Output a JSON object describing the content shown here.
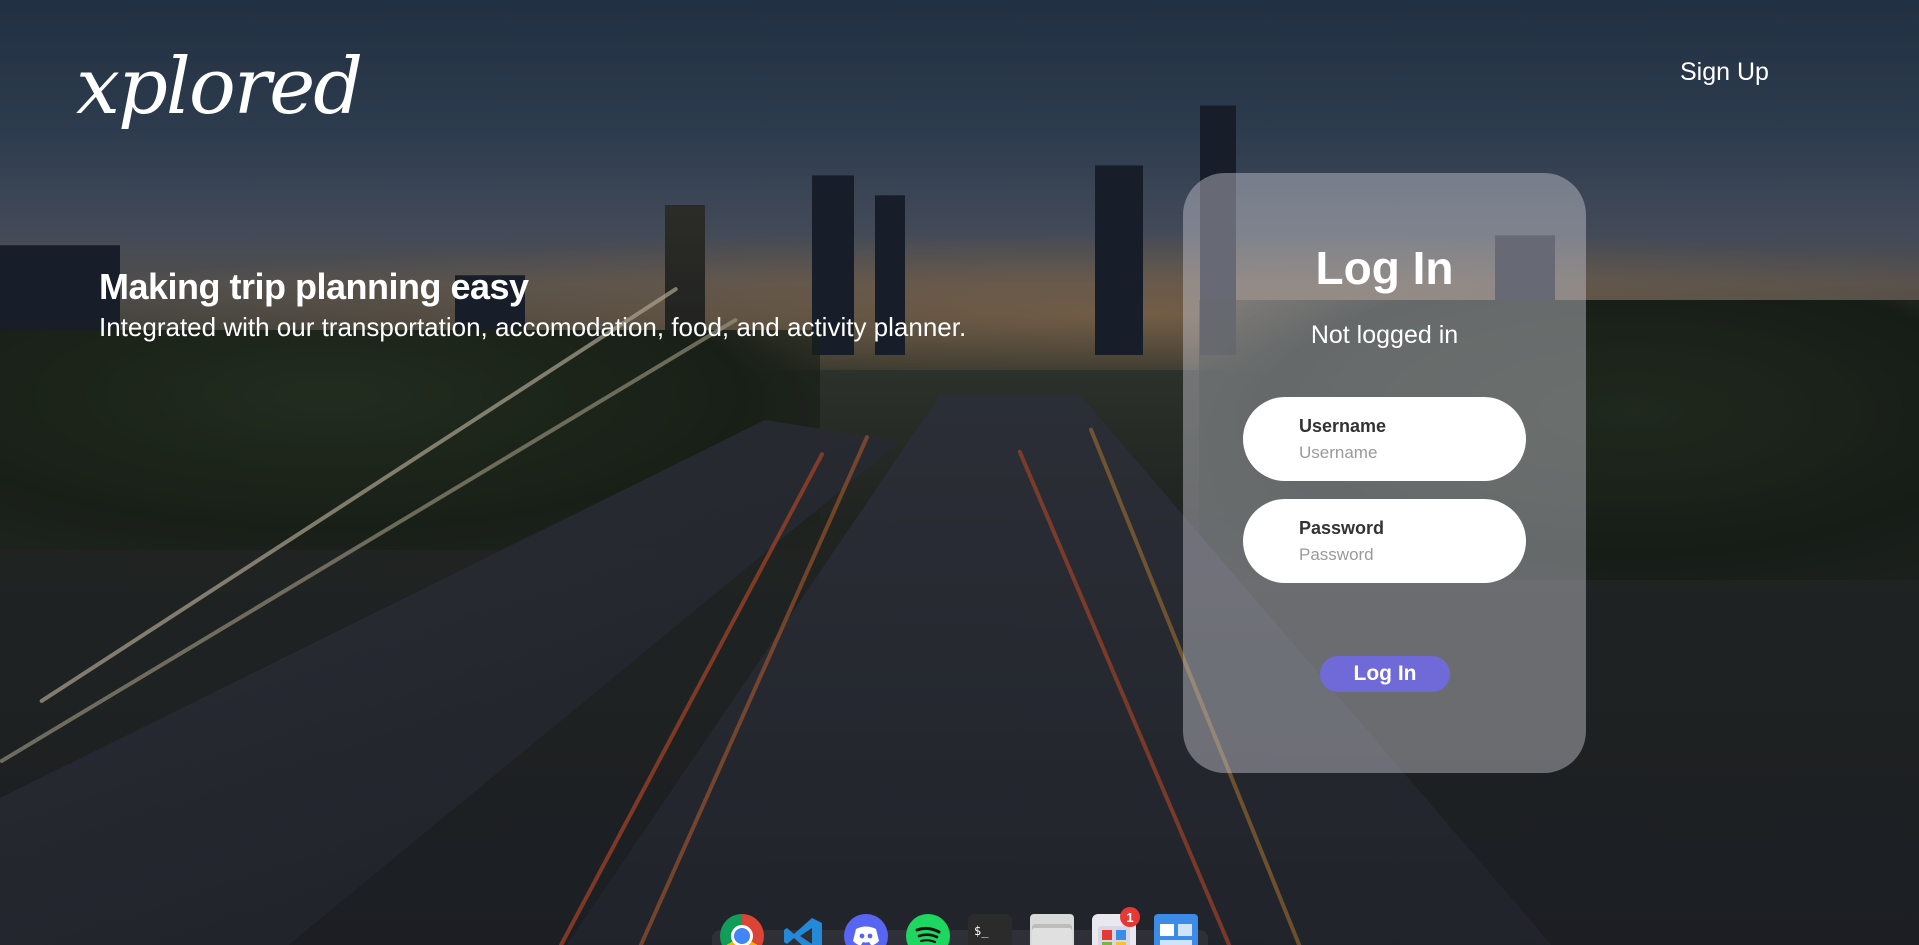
{
  "header": {
    "logo_text": "xplored",
    "signup_label": "Sign Up"
  },
  "hero": {
    "title": "Making trip planning easy",
    "subtitle": "Integrated with our transportation, accomodation, food, and activity planner."
  },
  "login": {
    "heading": "Log In",
    "status": "Not logged in",
    "username": {
      "label": "Username",
      "placeholder": "Username",
      "value": ""
    },
    "password": {
      "label": "Password",
      "placeholder": "Password",
      "value": ""
    },
    "submit_label": "Log In",
    "accent_color": "#6f6ad8"
  },
  "dock": {
    "apps": [
      {
        "name": "chrome-icon"
      },
      {
        "name": "vscode-icon"
      },
      {
        "name": "discord-icon"
      },
      {
        "name": "spotify-icon"
      },
      {
        "name": "terminal-icon",
        "glyph": "$_"
      },
      {
        "name": "files-icon"
      },
      {
        "name": "software-center-icon",
        "badge": "1"
      },
      {
        "name": "workspace-switcher-icon"
      }
    ]
  }
}
